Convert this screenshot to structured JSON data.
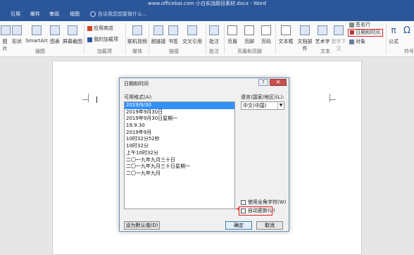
{
  "window": {
    "title": "www.officebai.com 小白实战题目素材.docx - Word"
  },
  "tabs": [
    "引用",
    "邮件",
    "审阅",
    "视图"
  ],
  "tell_me": "告诉我您想要做什么...",
  "ribbon": {
    "buttons": {
      "picture": "图片",
      "shapes": "形状",
      "smartart": "SmartArt",
      "chart": "图表",
      "screenshot": "屏幕截图",
      "store": "应用商店",
      "my_addins": "我的加载项",
      "online_video": "联机视频",
      "link": "超链接",
      "bookmark": "书签",
      "cross_ref": "交叉引用",
      "comment": "批注",
      "header": "页眉",
      "footer": "页脚",
      "page_number": "页码",
      "textbox": "文本框",
      "quick_parts": "文档部件",
      "wordart": "艺术字",
      "dropcap": "首字下沉",
      "signature_line": "签名行",
      "datetime": "日期和时间",
      "object": "对象",
      "equation": "公式",
      "symbol": "Ω"
    },
    "groups": {
      "illustrations": "插图",
      "addins": "加载项",
      "media": "媒体",
      "links": "链接",
      "comments": "批注",
      "header_footer": "页眉和页脚",
      "text": "文本",
      "symbols": "符号"
    }
  },
  "dialog": {
    "title": "日期和时间",
    "help": "?",
    "close": "✕",
    "formats_label": "可用格式(A):",
    "formats": [
      "2019/9/30",
      "2019年9月30日",
      "2019年9月30日星期一",
      "19.9.30",
      "2019年9月",
      "10时32分52秒",
      "10时32分",
      "上午10时32分",
      "二〇一九年九月三十日",
      "二〇一九年九月三十日星期一",
      "二〇一九年九月"
    ],
    "selected_index": 0,
    "language_label": "语言(国家/地区)(L):",
    "language_value": "中文(中国)",
    "use_full_width": "使用全角字符(W)",
    "auto_update": "自动更新(U)",
    "set_default": "设为默认值(D)",
    "ok": "确定",
    "cancel": "取消"
  },
  "colors": {
    "accent": "#2b579a",
    "highlight": "#e02020",
    "selection": "#3390ff"
  }
}
